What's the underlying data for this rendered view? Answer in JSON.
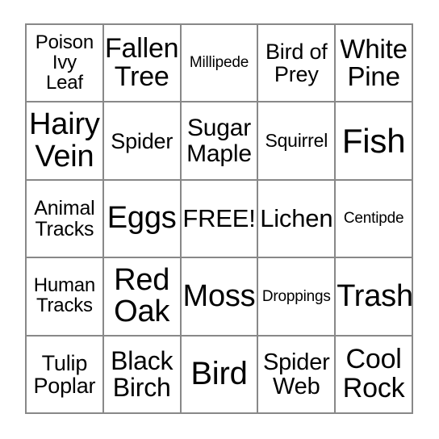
{
  "card": {
    "type": "bingo-card",
    "rows": 5,
    "columns": 5,
    "free_space_label": "FREE!",
    "free_space_position": {
      "row": 3,
      "column": 3
    },
    "theme": "nature-scavenger-hunt",
    "colors": {
      "border": "#888888",
      "background": "#ffffff",
      "text": "#000000"
    },
    "cells": [
      {
        "text": "Poison\nIvy\nLeaf",
        "label": "Poison Ivy Leaf",
        "font_size": "24px"
      },
      {
        "text": "Fallen\nTree",
        "label": "Fallen Tree",
        "font_size": "34px"
      },
      {
        "text": "Millipede",
        "label": "Millipede",
        "font_size": "19px"
      },
      {
        "text": "Bird of\nPrey",
        "label": "Bird of Prey",
        "font_size": "27px"
      },
      {
        "text": "White\nPine",
        "label": "White Pine",
        "font_size": "33px"
      },
      {
        "text": "Hairy\nVein",
        "label": "Hairy Vein",
        "font_size": "38px"
      },
      {
        "text": "Spider",
        "label": "Spider",
        "font_size": "27px"
      },
      {
        "text": "Sugar\nMaple",
        "label": "Sugar Maple",
        "font_size": "30px"
      },
      {
        "text": "Squirrel",
        "label": "Squirrel",
        "font_size": "23px"
      },
      {
        "text": "Fish",
        "label": "Fish",
        "font_size": "42px"
      },
      {
        "text": "Animal\nTracks",
        "label": "Animal Tracks",
        "font_size": "25px"
      },
      {
        "text": "Eggs",
        "label": "Eggs",
        "font_size": "38px"
      },
      {
        "text": "FREE!",
        "label": "FREE!",
        "font_size": "31px"
      },
      {
        "text": "Lichen",
        "label": "Lichen",
        "font_size": "31px"
      },
      {
        "text": "Centipde",
        "label": "Centipde",
        "font_size": "19px"
      },
      {
        "text": "Human\nTracks",
        "label": "Human Tracks",
        "font_size": "24px"
      },
      {
        "text": "Red\nOak",
        "label": "Red Oak",
        "font_size": "38px"
      },
      {
        "text": "Moss",
        "label": "Moss",
        "font_size": "38px"
      },
      {
        "text": "Droppings",
        "label": "Droppings",
        "font_size": "19px"
      },
      {
        "text": "Trash",
        "label": "Trash",
        "font_size": "38px"
      },
      {
        "text": "Tulip\nPoplar",
        "label": "Tulip Poplar",
        "font_size": "27px"
      },
      {
        "text": "Black\nBirch",
        "label": "Black Birch",
        "font_size": "32px"
      },
      {
        "text": "Bird",
        "label": "Bird",
        "font_size": "40px"
      },
      {
        "text": "Spider\nWeb",
        "label": "Spider Web",
        "font_size": "29px"
      },
      {
        "text": "Cool\nRock",
        "label": "Cool Rock",
        "font_size": "34px"
      }
    ]
  }
}
